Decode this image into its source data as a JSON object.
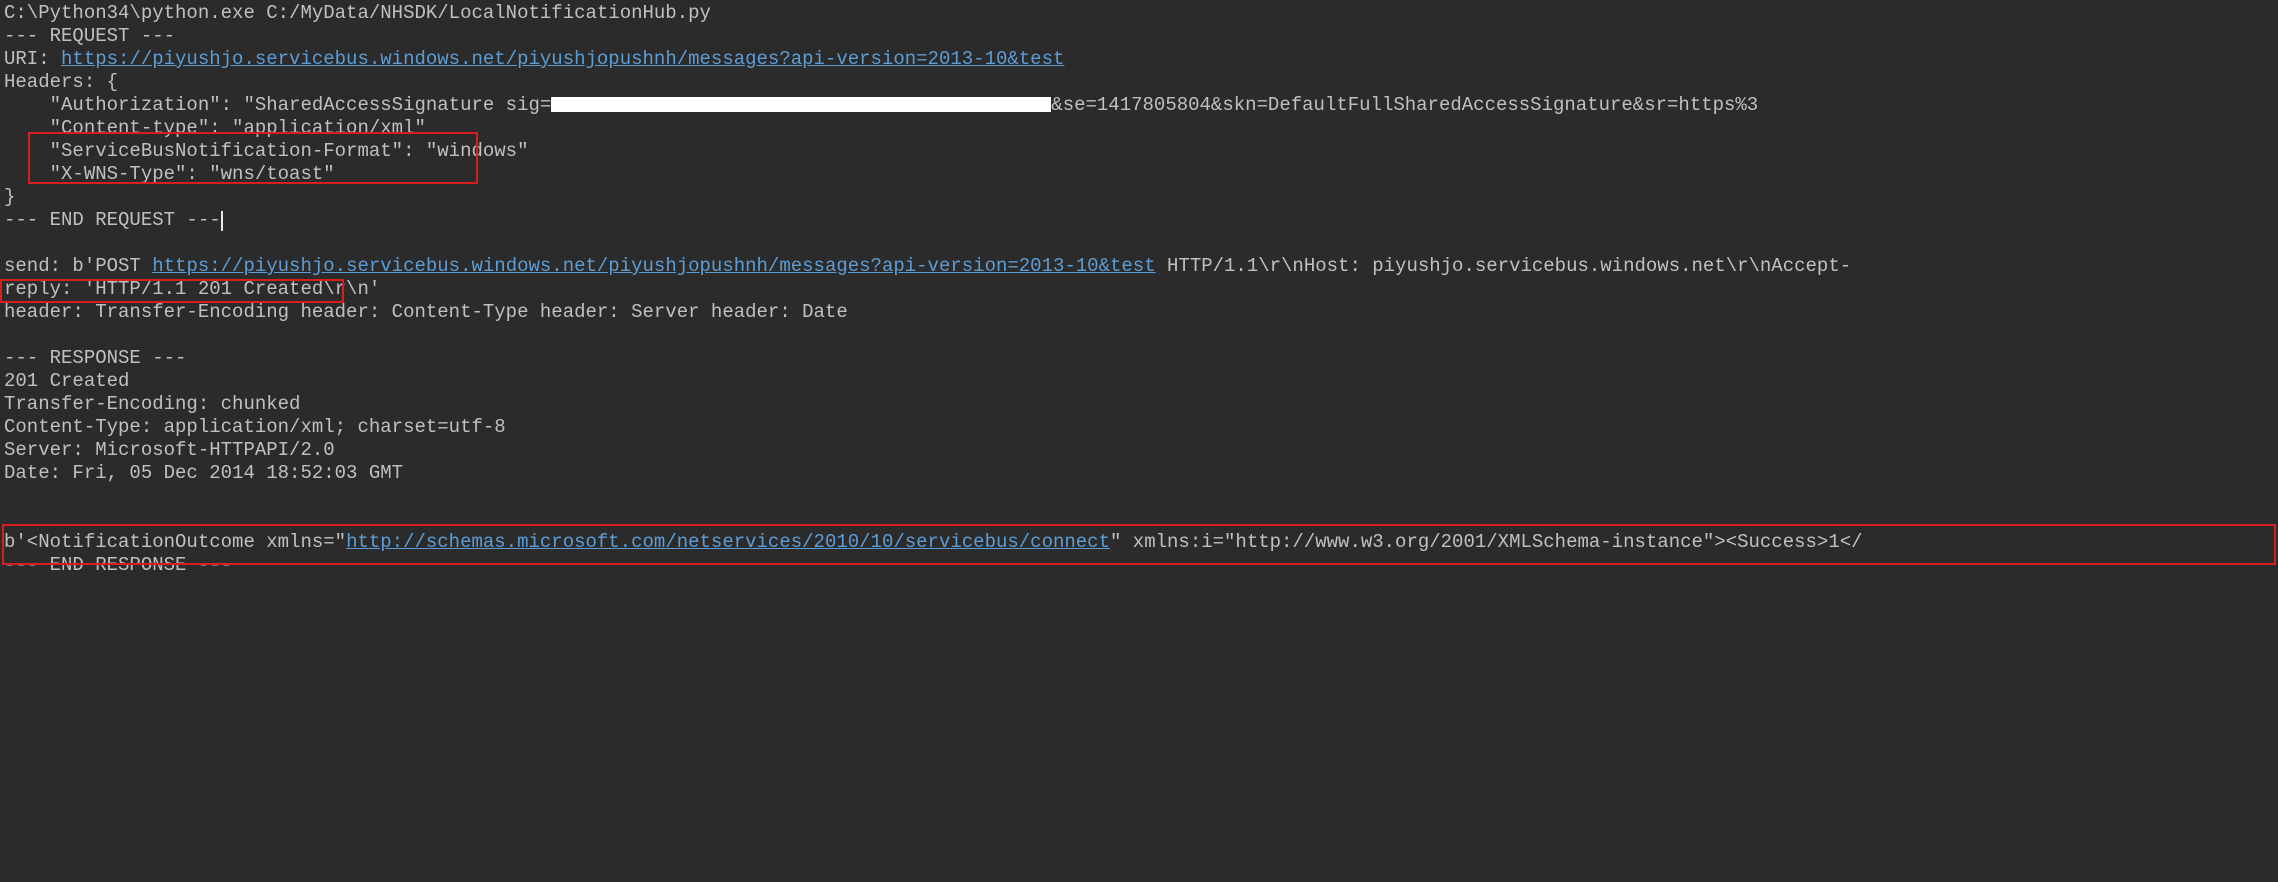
{
  "lines": {
    "cmd": "C:\\Python34\\python.exe C:/MyData/NHSDK/LocalNotificationHub.py",
    "req_start": "--- REQUEST ---",
    "uri_label": "URI: ",
    "uri_link": "https://piyushjo.servicebus.windows.net/piyushjopushnh/messages?api-version=2013-10&test",
    "headers_open": "Headers: {",
    "auth_pre": "    \"Authorization\": \"SharedAccessSignature sig=",
    "auth_post": "&se=1417805804&skn=DefaultFullSharedAccessSignature&sr=https%3",
    "content_type": "    \"Content-type\": \"application/xml\"",
    "sb_format": "    \"ServiceBusNotification-Format\": \"windows\"",
    "wns_type": "    \"X-WNS-Type\": \"wns/toast\"",
    "headers_close": "}",
    "req_end": "--- END REQUEST ---",
    "send_pre": "send: b'POST ",
    "send_link": "https://piyushjo.servicebus.windows.net/piyushjopushnh/messages?api-version=2013-10&test",
    "send_post": " HTTP/1.1\\r\\nHost: piyushjo.servicebus.windows.net\\r\\nAccept-",
    "reply": "reply: 'HTTP/1.1 201 Created\\r\\n'",
    "header_line": "header: Transfer-Encoding header: Content-Type header: Server header: Date",
    "resp_start": "--- RESPONSE ---",
    "resp_status": "201 Created",
    "resp_te": "Transfer-Encoding: chunked",
    "resp_ct": "Content-Type: application/xml; charset=utf-8",
    "resp_server": "Server: Microsoft-HTTPAPI/2.0",
    "resp_date": "Date: Fri, 05 Dec 2014 18:52:03 GMT",
    "body_pre": "b'<NotificationOutcome xmlns=\"",
    "body_link": "http://schemas.microsoft.com/netservices/2010/10/servicebus/connect",
    "body_post": "\" xmlns:i=\"http://www.w3.org/2001/XMLSchema-instance\"><Success>1</",
    "resp_end": "--- END RESPONSE ---"
  }
}
